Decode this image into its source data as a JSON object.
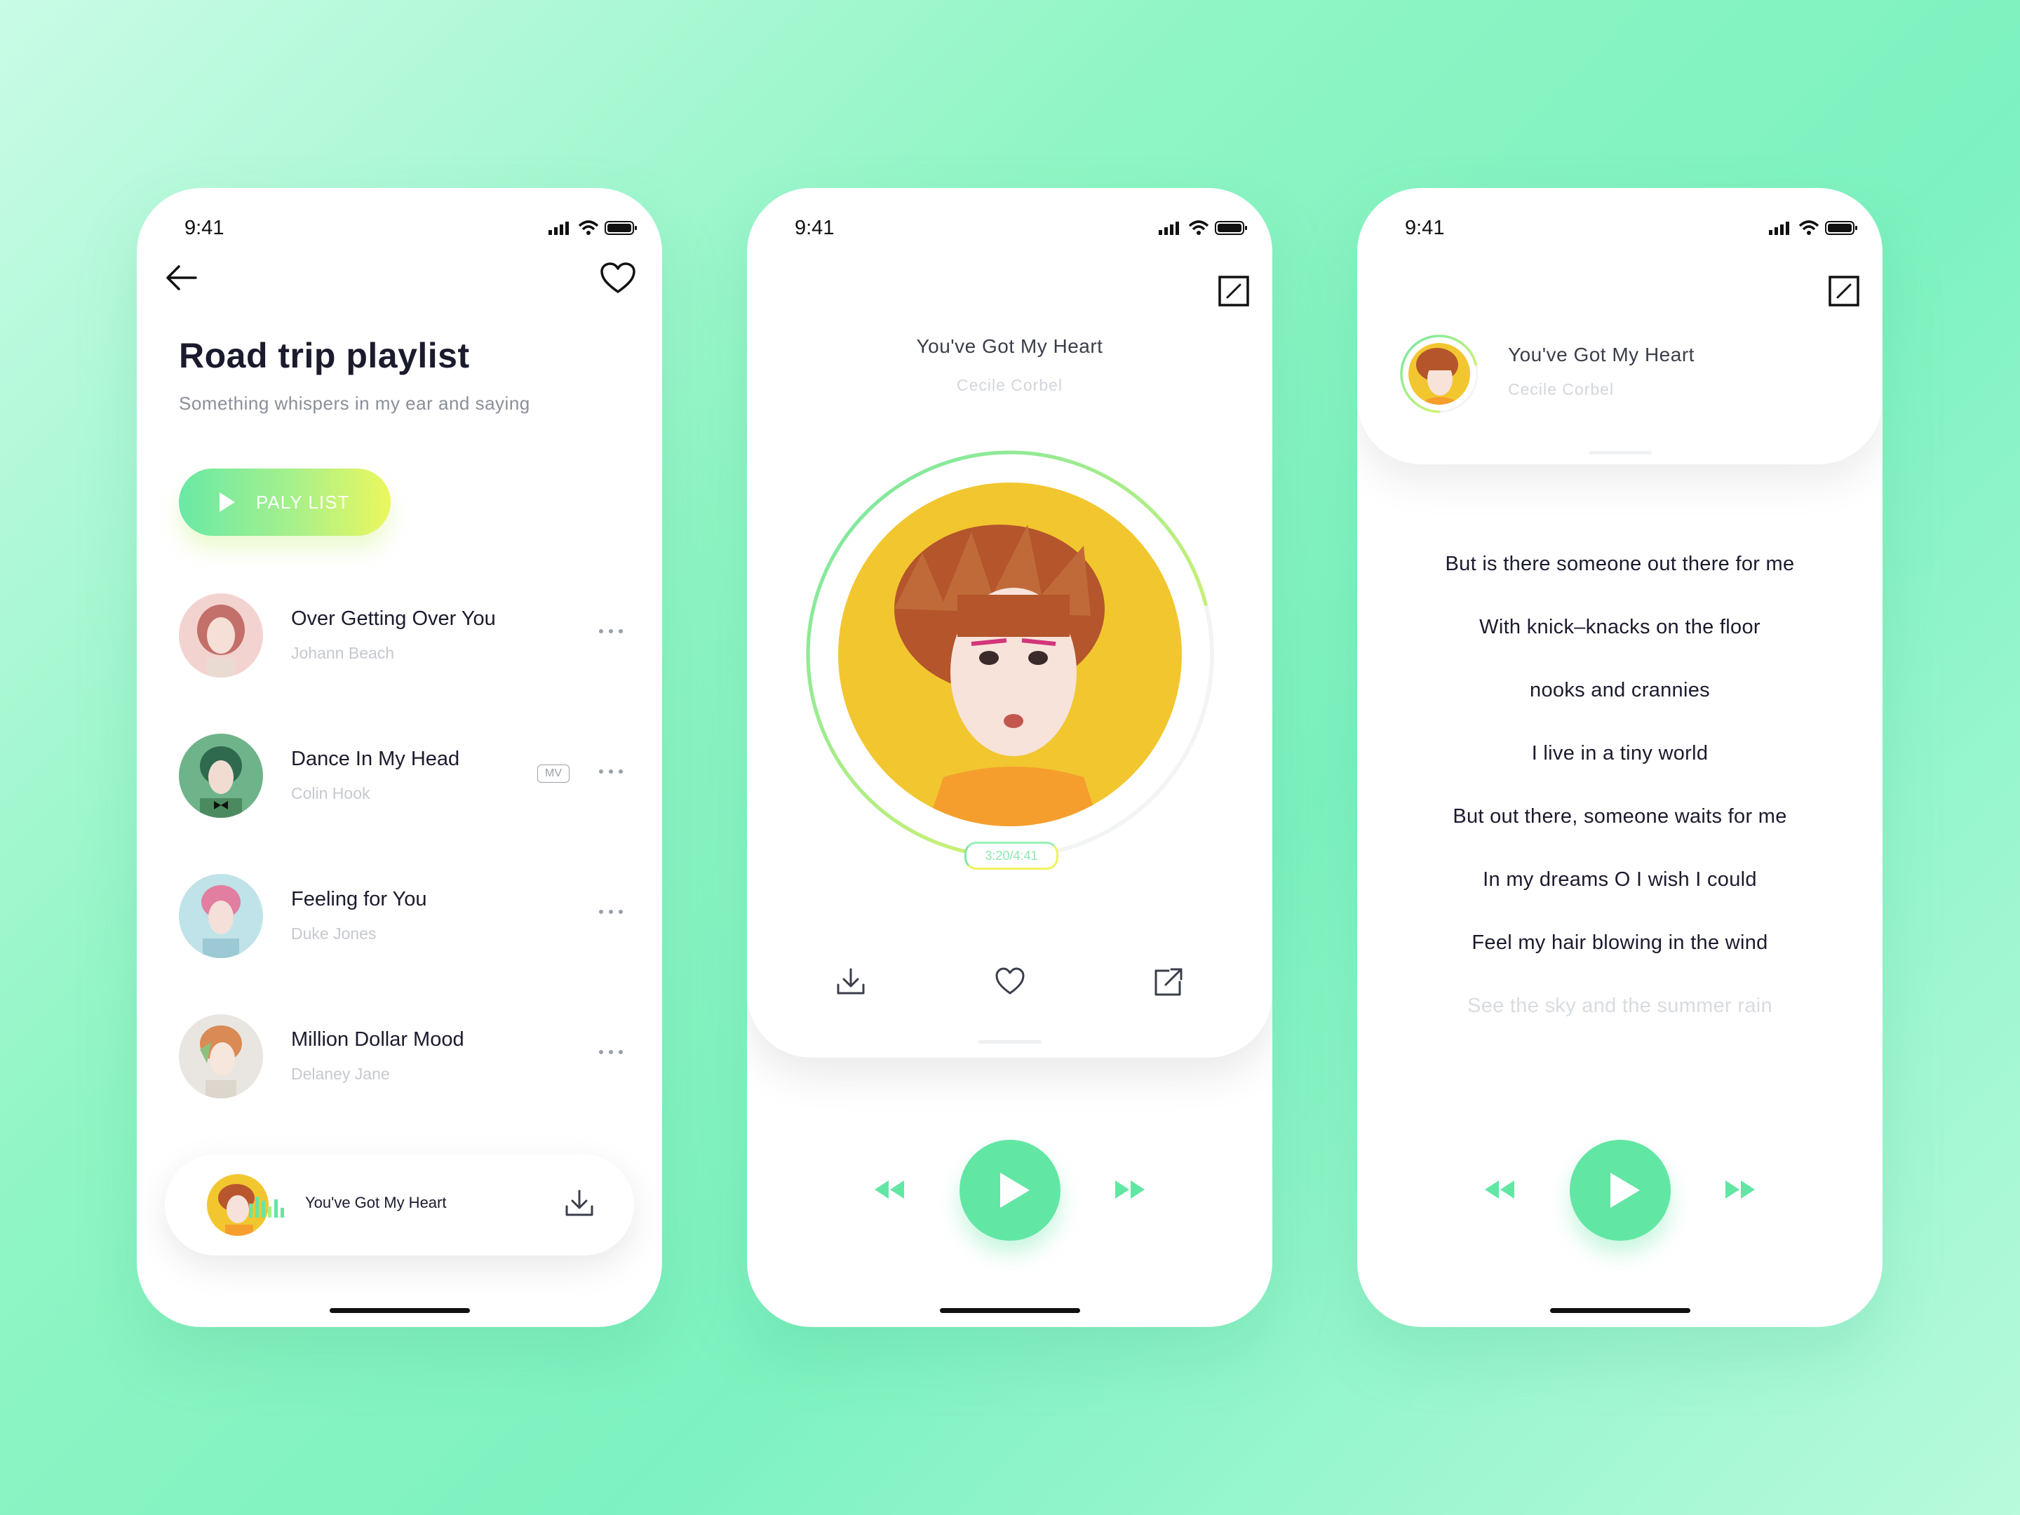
{
  "status": {
    "time": "9:41"
  },
  "playlist": {
    "title": "Road trip playlist",
    "subtitle": "Something whispers in my ear and saying",
    "play_button_label": "PALY LIST",
    "songs": [
      {
        "title": "Over Getting Over You",
        "artist": "Johann Beach",
        "mv": false
      },
      {
        "title": "Dance In My Head",
        "artist": "Colin Hook",
        "mv": true,
        "mv_label": "MV"
      },
      {
        "title": "Feeling for You",
        "artist": "Duke Jones",
        "mv": false
      },
      {
        "title": "Million Dollar Mood",
        "artist": "Delaney Jane",
        "mv": false
      }
    ],
    "mini_player": {
      "title": "You've Got My Heart"
    }
  },
  "now_playing": {
    "title": "You've Got My Heart",
    "artist": "Cecile Corbel",
    "time_display": "3:20/4:41",
    "progress_fraction": 0.71
  },
  "lyrics_view": {
    "title": "You've Got My Heart",
    "artist": "Cecile Corbel",
    "lines": [
      "But is there someone out there for me",
      "With knick–knacks on the floor",
      "nooks and crannies",
      "I live in a tiny world",
      "But out there, someone waits for me",
      "In my dreams O I wish I could",
      "Feel my hair blowing in the wind",
      "See the sky and the summer rain"
    ]
  },
  "colors": {
    "accent_green": "#62e6a4",
    "accent_yellow": "#ecf75e",
    "text_dark": "#1b1b2e",
    "text_muted": "#c5c9cf"
  }
}
